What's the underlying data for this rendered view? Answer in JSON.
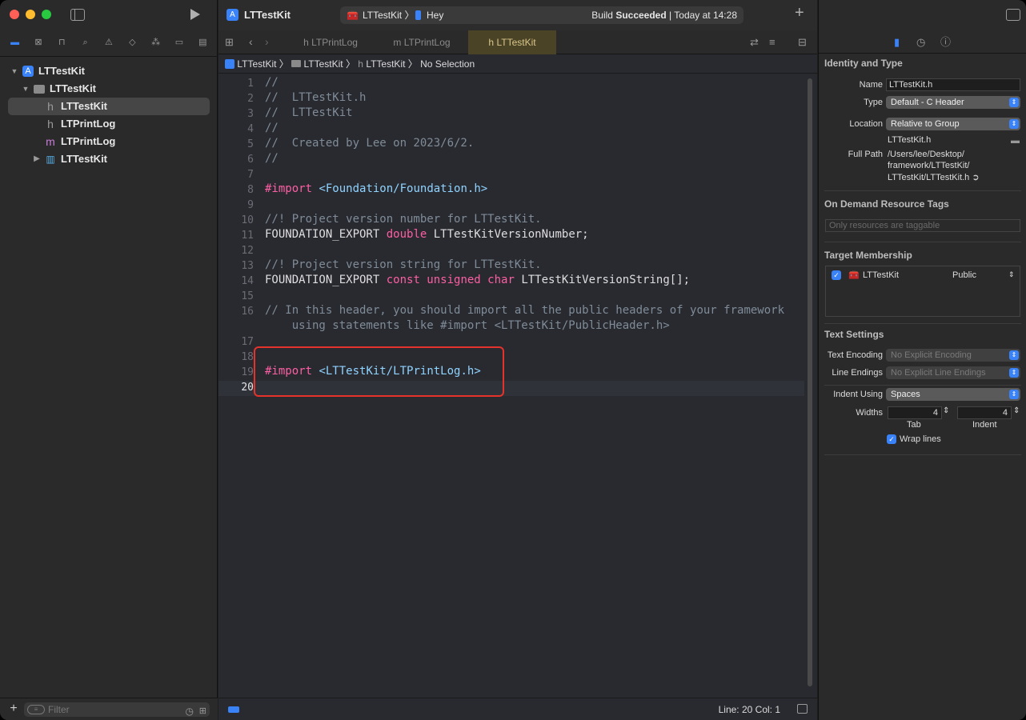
{
  "project_title": "LTTestKit",
  "scheme": {
    "target": "LTTestKit",
    "device": "Hey",
    "status_prefix": "Build",
    "status_bold": "Succeeded",
    "status_time": "| Today at 14:28"
  },
  "navigator": {
    "items": [
      {
        "label": "LTTestKit"
      },
      {
        "label": "LTTestKit"
      },
      {
        "label": "LTTestKit",
        "icon": "h"
      },
      {
        "label": "LTPrintLog",
        "icon": "h"
      },
      {
        "label": "LTPrintLog",
        "icon": "m"
      },
      {
        "label": "LTTestKit"
      }
    ],
    "filter_placeholder": "Filter"
  },
  "tabs": [
    {
      "icon": "h",
      "label": "LTPrintLog"
    },
    {
      "icon": "m",
      "label": "LTPrintLog"
    },
    {
      "icon": "h",
      "label": "LTTestKit"
    }
  ],
  "jumpbar": [
    "LTTestKit",
    "LTTestKit",
    "LTTestKit",
    "No Selection"
  ],
  "code": {
    "lines": [
      {
        "n": "1",
        "t": "//"
      },
      {
        "n": "2",
        "t": "//  LTTestKit.h"
      },
      {
        "n": "3",
        "t": "//  LTTestKit"
      },
      {
        "n": "4",
        "t": "//"
      },
      {
        "n": "5",
        "t": "//  Created by Lee on 2023/6/2."
      },
      {
        "n": "6",
        "t": "//"
      },
      {
        "n": "7",
        "t": ""
      },
      {
        "n": "8",
        "kw": "#import",
        "str": "<Foundation/Foundation.h>"
      },
      {
        "n": "9",
        "t": ""
      },
      {
        "n": "10",
        "t": "//! Project version number for LTTestKit."
      },
      {
        "n": "11",
        "plain": "FOUNDATION_EXPORT",
        "kw": "double",
        "rest": "LTTestKitVersionNumber;"
      },
      {
        "n": "12",
        "t": ""
      },
      {
        "n": "13",
        "t": "//! Project version string for LTTestKit."
      },
      {
        "n": "14",
        "plain": "FOUNDATION_EXPORT",
        "kw": "const unsigned char",
        "rest": "LTTestKitVersionString[];"
      },
      {
        "n": "15",
        "t": ""
      },
      {
        "n": "16",
        "t": "// In this header, you should import all the public headers of your framework",
        "t2": "    using statements like #import <LTTestKit/PublicHeader.h>"
      },
      {
        "n": "17",
        "t": ""
      },
      {
        "n": "18",
        "t": ""
      },
      {
        "n": "19",
        "kw": "#import",
        "str": "<LTTestKit/LTPrintLog.h>"
      },
      {
        "n": "20",
        "t": ""
      }
    ]
  },
  "status_bar": {
    "line_col": "Line: 20  Col: 1"
  },
  "inspector": {
    "identity_title": "Identity and Type",
    "name_label": "Name",
    "name_value": "LTTestKit.h",
    "type_label": "Type",
    "type_value": "Default - C Header",
    "location_label": "Location",
    "location_value": "Relative to Group",
    "location_file": "LTTestKit.h",
    "fullpath_label": "Full Path",
    "fullpath_1": "/Users/lee/Desktop/",
    "fullpath_2": "framework/LTTestKit/",
    "fullpath_3": "LTTestKit/LTTestKit.h",
    "odr_title": "On Demand Resource Tags",
    "odr_placeholder": "Only resources are taggable",
    "target_title": "Target Membership",
    "target_name": "LTTestKit",
    "target_visibility": "Public",
    "text_title": "Text Settings",
    "encoding_label": "Text Encoding",
    "encoding_value": "No Explicit Encoding",
    "endings_label": "Line Endings",
    "endings_value": "No Explicit Line Endings",
    "indent_using_label": "Indent Using",
    "indent_using_value": "Spaces",
    "widths_label": "Widths",
    "tab_value": "4",
    "indent_value": "4",
    "tab_label": "Tab",
    "indent_label": "Indent",
    "wrap_label": "Wrap lines"
  }
}
